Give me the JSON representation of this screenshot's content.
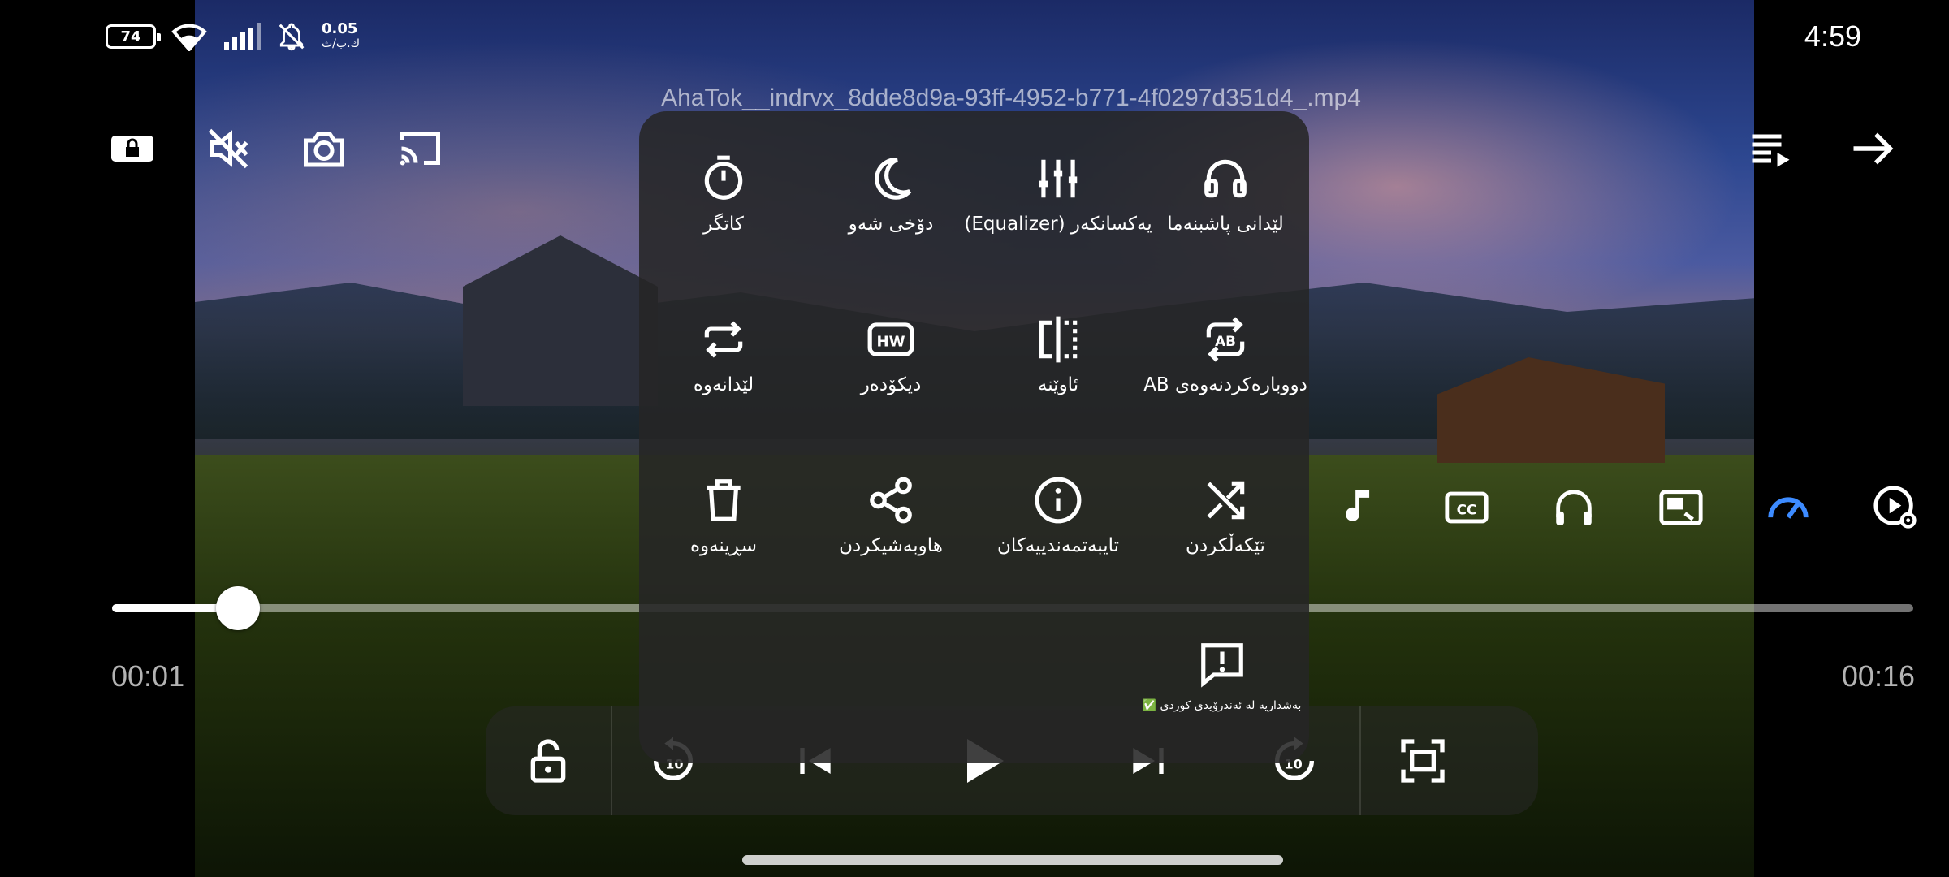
{
  "status_bar": {
    "battery": "74",
    "net_speed_value": "0.05",
    "net_speed_unit": "ك.ب/ث",
    "clock": "4:59"
  },
  "player": {
    "file_title": "AhaTok__indrvx_8dde8d9a-93ff-4952-b771-4f0297d351d4_.mp4",
    "time_current": "00:01",
    "time_total": "00:16",
    "progress": 0.07,
    "accent_color": "#3d8bff"
  },
  "menu": {
    "items": [
      {
        "label": "لێدانی پاشبنەما",
        "icon": "headphones-icon"
      },
      {
        "label": "یەکسانکەر (Equalizer)",
        "icon": "equalizer-icon"
      },
      {
        "label": "دۆخی شەو",
        "icon": "moon-icon"
      },
      {
        "label": "کاتگر",
        "icon": "timer-icon"
      },
      {
        "label": "دووبارەکردنەوەی AB",
        "icon": "ab-repeat-icon"
      },
      {
        "label": "ئاوێنە",
        "icon": "mirror-icon"
      },
      {
        "label": "دیکۆدەر",
        "icon": "hw-decoder-icon"
      },
      {
        "label": "لێدانەوە",
        "icon": "repeat-icon"
      },
      {
        "label": "تێکەڵکردن",
        "icon": "shuffle-icon"
      },
      {
        "label": "تایبەتمەندییەکان",
        "icon": "info-icon"
      },
      {
        "label": "هاوبەشیکردن",
        "icon": "share-icon"
      },
      {
        "label": "سڕینەوە",
        "icon": "delete-icon"
      }
    ],
    "feedback_label": "✅ بەشداریە لە ئەندرۆیدی کوردی"
  }
}
